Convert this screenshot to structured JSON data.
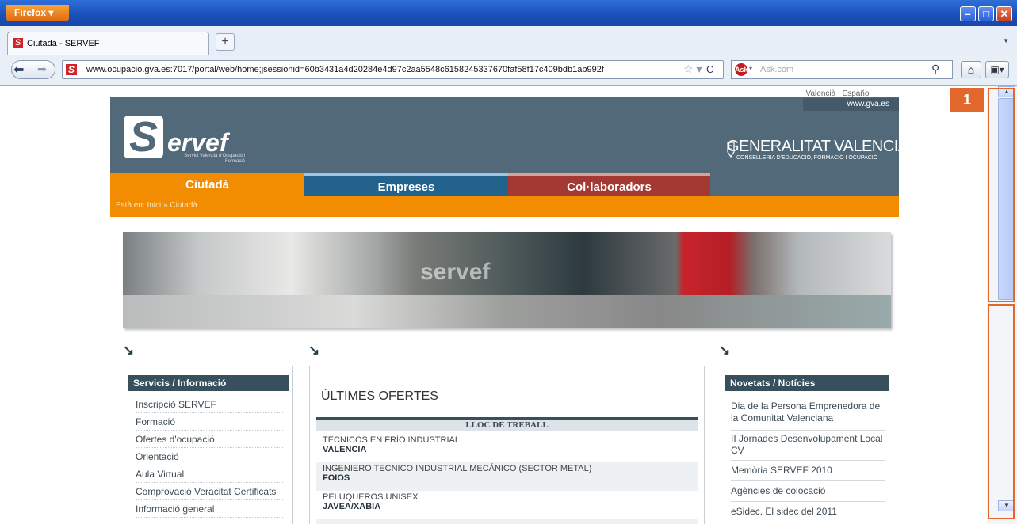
{
  "browser": {
    "menu_button": "Firefox ▾",
    "tab_title": "Ciutadà - SERVEF",
    "new_tab": "+",
    "url": "www.ocupacio.gva.es:7017/portal/web/home;jsessionid=60b3431a4d20284e4d97c2aa5548c6158245337670faf58f17c409bdb1ab992f",
    "search_placeholder": "Ask.com",
    "favicon_letter": "S"
  },
  "page": {
    "languages": "_Valencià _Español",
    "gva_link": "www.gva.es",
    "logo_letter": "S",
    "logo_word": "ervef",
    "logo_subtitle": "Servici Valencià d'Ocupació i Formació",
    "gv_title": "GENERALITAT VALENCIANA",
    "gv_subtitle": "CONSELLERIA D'EDUCACIÓ, FORMACIÓ I OCUPACIÓ",
    "nav_tabs": [
      "Ciutadà",
      "Empreses",
      "Col·laboradors"
    ],
    "breadcrumb": "Està en: Inici » Ciutadà",
    "banner_text": "servef",
    "services": {
      "title": "Servicis / Informació",
      "items": [
        "Inscripció SERVEF",
        "Formació",
        "Ofertes d'ocupació",
        "Orientació",
        "Aula Virtual",
        "Comprovació Veracitat Certificats",
        "Informació general"
      ]
    },
    "offers": {
      "title": "ÚLTIMES OFERTES",
      "column_header": "LLOC DE TREBALL",
      "jobs": [
        {
          "title": "TÉCNICOS EN FRÍO INDUSTRIAL",
          "location": "VALENCIA"
        },
        {
          "title": "INGENIERO TECNICO INDUSTRIAL MECÁNICO (SECTOR METAL)",
          "location": "FOIOS"
        },
        {
          "title": "PELUQUEROS UNISEX",
          "location": "JAVEA/XABIA"
        }
      ]
    },
    "news": {
      "title": "Novetats / Notícies",
      "items": [
        "Dia de la Persona Emprenedora de la Comunitat Valenciana",
        "II Jornades Desenvolupament Local CV",
        "Memòria SERVEF 2010",
        "Agències de colocació",
        "eSidec. El sidec del 2011"
      ]
    }
  },
  "annotation": {
    "badge": "1",
    "color": "#e2672a"
  },
  "colors": {
    "ciutada": "#f28c00",
    "empreses": "#22628c",
    "colaboradors": "#a43832",
    "banner": "#526979"
  },
  "icons": [
    "back-arrow-icon",
    "forward-arrow-icon",
    "bookmark-star-icon",
    "reload-icon",
    "search-icon",
    "home-icon",
    "addon-icon",
    "minimize-icon",
    "maximize-icon",
    "close-icon"
  ]
}
